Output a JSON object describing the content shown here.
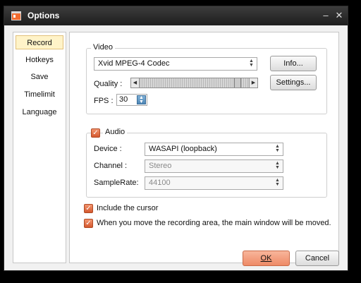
{
  "window": {
    "title": "Options"
  },
  "sidebar": {
    "items": [
      {
        "label": "Record",
        "active": true
      },
      {
        "label": "Hotkeys"
      },
      {
        "label": "Save"
      },
      {
        "label": "Timelimit"
      },
      {
        "label": "Language"
      }
    ]
  },
  "video": {
    "group_title": "Video",
    "codec": "Xvid MPEG-4 Codec",
    "info_button": "Info...",
    "quality_label": "Quality :",
    "quality_level": 0.92,
    "settings_button": "Settings...",
    "fps_label": "FPS :",
    "fps_value": "30"
  },
  "audio": {
    "enabled": true,
    "label": "Audio",
    "device_label": "Device :",
    "device_value": "WASAPI (loopback)",
    "channel_label": "Channel :",
    "channel_value": "Stereo",
    "samplerate_label": "SampleRate:",
    "samplerate_value": "44100"
  },
  "options": {
    "include_cursor_label": "Include the cursor",
    "include_cursor_checked": true,
    "move_window_label": "When you move the recording area, the main window will be moved.",
    "move_window_checked": true
  },
  "footer": {
    "ok_label": "OK",
    "cancel_label": "Cancel"
  },
  "colors": {
    "accent": "#ee8a66",
    "selected_bg": "#fff3c8",
    "titlebar": "#2a2a2a"
  },
  "icons": {
    "app": "app-icon",
    "minimize": "minimize-icon",
    "close": "close-icon",
    "check": "check-icon",
    "dropdown": "chevron-updown-icon"
  }
}
